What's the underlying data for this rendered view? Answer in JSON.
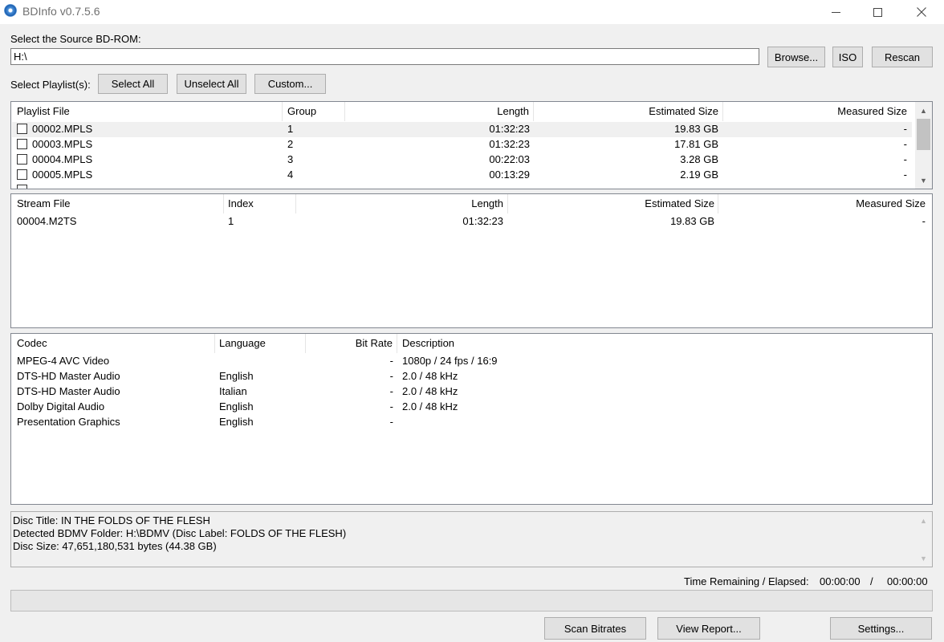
{
  "window": {
    "title": "BDInfo v0.7.5.6"
  },
  "source": {
    "label": "Select the Source BD-ROM:",
    "value": "H:\\",
    "browse_label": "Browse...",
    "iso_label": "ISO",
    "rescan_label": "Rescan"
  },
  "playlist_controls": {
    "label": "Select Playlist(s):",
    "select_all": "Select All",
    "unselect_all": "Unselect All",
    "custom": "Custom..."
  },
  "playlists": {
    "headers": [
      "Playlist File",
      "Group",
      "Length",
      "Estimated Size",
      "Measured Size"
    ],
    "rows": [
      {
        "file": "00002.MPLS",
        "group": "1",
        "length": "01:32:23",
        "est": "19.83 GB",
        "meas": "-"
      },
      {
        "file": "00003.MPLS",
        "group": "2",
        "length": "01:32:23",
        "est": "17.81 GB",
        "meas": "-"
      },
      {
        "file": "00004.MPLS",
        "group": "3",
        "length": "00:22:03",
        "est": "3.28 GB",
        "meas": "-"
      },
      {
        "file": "00005.MPLS",
        "group": "4",
        "length": "00:13:29",
        "est": "2.19 GB",
        "meas": "-"
      }
    ]
  },
  "streams": {
    "headers": [
      "Stream File",
      "Index",
      "Length",
      "Estimated Size",
      "Measured Size"
    ],
    "rows": [
      {
        "file": "00004.M2TS",
        "index": "1",
        "length": "01:32:23",
        "est": "19.83 GB",
        "meas": "-"
      }
    ]
  },
  "codecs": {
    "headers": [
      "Codec",
      "Language",
      "Bit Rate",
      "Description"
    ],
    "rows": [
      {
        "codec": "MPEG-4 AVC Video",
        "language": "",
        "bitrate": "-",
        "desc": "1080p / 24 fps / 16:9"
      },
      {
        "codec": "DTS-HD Master Audio",
        "language": "English",
        "bitrate": "-",
        "desc": "2.0 / 48 kHz"
      },
      {
        "codec": "DTS-HD Master Audio",
        "language": "Italian",
        "bitrate": "-",
        "desc": "2.0 / 48 kHz"
      },
      {
        "codec": "Dolby Digital Audio",
        "language": "English",
        "bitrate": "-",
        "desc": "2.0 / 48 kHz"
      },
      {
        "codec": "Presentation Graphics",
        "language": "English",
        "bitrate": "-",
        "desc": ""
      }
    ]
  },
  "disc_info": {
    "lines": [
      "Disc Title: IN THE FOLDS OF THE FLESH",
      "Detected BDMV Folder: H:\\BDMV (Disc Label: FOLDS OF THE FLESH)",
      "Disc Size: 47,651,180,531 bytes (44.38 GB)"
    ]
  },
  "time": {
    "label": "Time Remaining / Elapsed:",
    "remaining": "00:00:00",
    "separator": "/",
    "elapsed": "00:00:00"
  },
  "progress": {
    "value": 0
  },
  "actions": {
    "scan_bitrates": "Scan Bitrates",
    "view_report": "View Report...",
    "settings": "Settings..."
  }
}
